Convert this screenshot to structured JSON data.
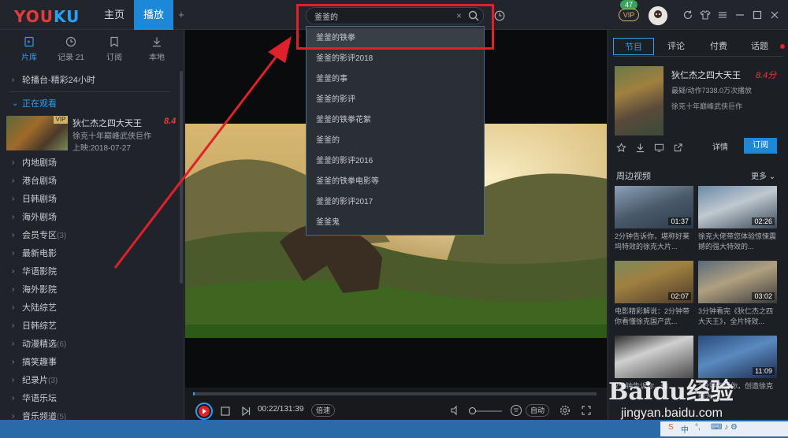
{
  "app": {
    "logo_part1": "YOU",
    "logo_part2": "KU"
  },
  "topnav": {
    "home": "主页",
    "play": "播放",
    "add": "+"
  },
  "search": {
    "value": "釜釜的",
    "clear": "×"
  },
  "vip": {
    "label": "VIP",
    "count": "47"
  },
  "sidebar": {
    "tabs": [
      {
        "label": "片库",
        "icon": "library-icon"
      },
      {
        "label": "记录 21",
        "icon": "history-icon"
      },
      {
        "label": "订阅",
        "icon": "subscribe-icon"
      },
      {
        "label": "本地",
        "icon": "download-icon"
      }
    ],
    "carousel": "轮播台-精彩24小时",
    "watching_header": "正在观看",
    "watching": {
      "title": "狄仁杰之四大天王",
      "score": "8.4",
      "desc": "徐克十年巅峰武侠巨作",
      "date": "上映:2018-07-27",
      "vip": "VIP"
    },
    "items": [
      {
        "label": "内地剧场",
        "count": ""
      },
      {
        "label": "港台剧场",
        "count": ""
      },
      {
        "label": "日韩剧场",
        "count": ""
      },
      {
        "label": "海外剧场",
        "count": ""
      },
      {
        "label": "会员专区",
        "count": "(3)"
      },
      {
        "label": "最新电影",
        "count": ""
      },
      {
        "label": "华语影院",
        "count": ""
      },
      {
        "label": "海外影院",
        "count": ""
      },
      {
        "label": "大陆综艺",
        "count": ""
      },
      {
        "label": "日韩综艺",
        "count": ""
      },
      {
        "label": "动漫精选",
        "count": "(6)"
      },
      {
        "label": "搞笑趣事",
        "count": ""
      },
      {
        "label": "纪录片",
        "count": "(3)"
      },
      {
        "label": "华语乐坛",
        "count": ""
      },
      {
        "label": "音乐频道",
        "count": "(5)"
      }
    ]
  },
  "dropdown": [
    "釜釜的铁拳",
    "釜釜的影评2018",
    "釜釜的事",
    "釜釜的影评",
    "釜釜的铁拳花絮",
    "釜釜的",
    "釜釜的影评2016",
    "釜釜的铁拳电影等",
    "釜釜的影评2017",
    "釜釜鬼"
  ],
  "player": {
    "time": "00:22/131:39",
    "speed": "倍速",
    "quality": "自动",
    "progress_fraction": 0.003
  },
  "right": {
    "tabs": [
      "节目",
      "评论",
      "付费",
      "话题"
    ],
    "movie": {
      "title": "狄仁杰之四大天王",
      "score": "8.4分",
      "meta": "最疑/动作7338.0万次播放",
      "desc": "徐克十年巅峰武侠巨作"
    },
    "detail": "详情",
    "subscribe": "订阅",
    "section": "周边视频",
    "more": "更多 ⌄",
    "videos": [
      {
        "duration": "01:37",
        "title": "2分钟告诉你，堪称好莱坞特效的徐克大片..."
      },
      {
        "duration": "02:26",
        "title": "徐克大佬带您体验惊悚震撼的强大特效的..."
      },
      {
        "duration": "02:07",
        "title": "电影精彩解说：2分钟带你看懂徐克国产武..."
      },
      {
        "duration": "03:02",
        "title": "3分钟看完《狄仁杰之四大天王》，全片特效..."
      },
      {
        "duration": "",
        "title": "2分钟告诉你，徐..."
      },
      {
        "duration": "11:09",
        "title": "2分钟告诉你，创造徐克的大..."
      }
    ]
  },
  "watermark": {
    "brand": "Baidu经验",
    "url": "jingyan.baidu.com"
  },
  "tray": {
    "ime": "中",
    "punct": "°,",
    "extra": "⌨ ♪ ⚙"
  }
}
